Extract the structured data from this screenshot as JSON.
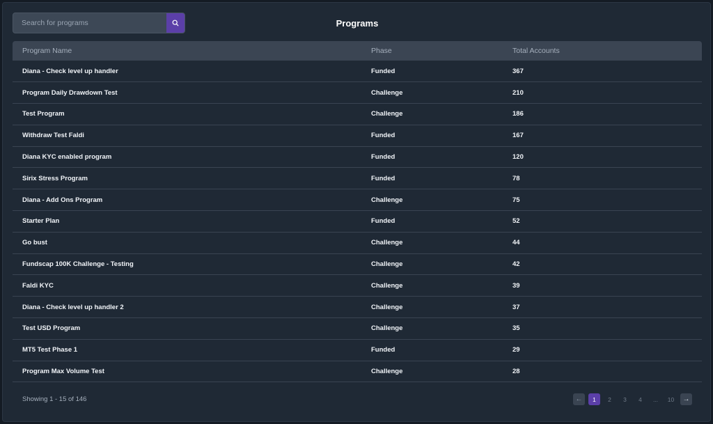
{
  "header": {
    "title": "Programs",
    "search_placeholder": "Search for programs"
  },
  "table": {
    "columns": [
      "Program Name",
      "Phase",
      "Total Accounts"
    ],
    "rows": [
      [
        "Diana - Check level up handler",
        "Funded",
        "367"
      ],
      [
        "Program Daily Drawdown Test",
        "Challenge",
        "210"
      ],
      [
        "Test Program",
        "Challenge",
        "186"
      ],
      [
        "Withdraw Test Faldi",
        "Funded",
        "167"
      ],
      [
        "Diana KYC enabled program",
        "Funded",
        "120"
      ],
      [
        "Sirix Stress Program",
        "Funded",
        "78"
      ],
      [
        "Diana - Add Ons Program",
        "Challenge",
        "75"
      ],
      [
        "Starter Plan",
        "Funded",
        "52"
      ],
      [
        "Go bust",
        "Challenge",
        "44"
      ],
      [
        "Fundscap 100K Challenge - Testing",
        "Challenge",
        "42"
      ],
      [
        "Faldi KYC",
        "Challenge",
        "39"
      ],
      [
        "Diana - Check level up handler 2",
        "Challenge",
        "37"
      ],
      [
        "Test USD Program",
        "Challenge",
        "35"
      ],
      [
        "MT5 Test Phase 1",
        "Funded",
        "29"
      ],
      [
        "Program Max Volume Test",
        "Challenge",
        "28"
      ]
    ]
  },
  "footer": {
    "showing": "Showing 1 - 15 of 146",
    "pages": [
      "1",
      "2",
      "3",
      "4",
      "...",
      "10"
    ],
    "active_page": "1",
    "prev_icon": "arrow-left-icon",
    "next_icon": "arrow-right-icon"
  },
  "colors": {
    "accent": "#5b3fa8",
    "panel": "#1f2935",
    "header_row": "#3b4553"
  }
}
